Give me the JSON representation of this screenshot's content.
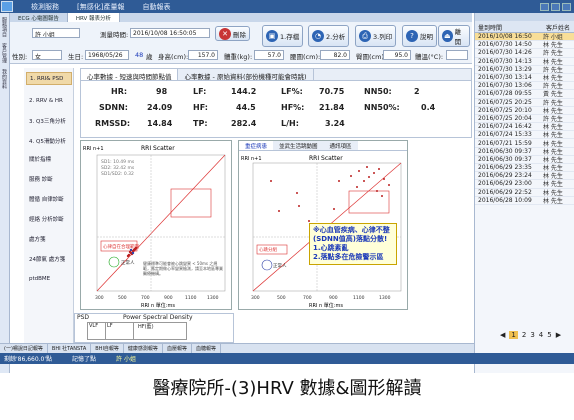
{
  "window": {
    "tab1": "檢測服務",
    "tab2": "[無感化]產量報",
    "tab3": "自動報表"
  },
  "left_rail": [
    "服務項目",
    "客戶管理",
    "我的資料"
  ],
  "tabstrip": [
    "ECG 心電圖報告",
    "HRV 報表分析"
  ],
  "form": {
    "name_label": "許 小姐",
    "measure_label": "測量時間:",
    "measure_value": "2016/10/08 16:50:05",
    "delete": "刪除",
    "gender_label": "性別:",
    "gender_value": "女",
    "birth_label": "生日:",
    "birth_value": "1968/05/26",
    "age": "48",
    "age_unit": "歲",
    "height_label": "身高(cm):",
    "height_value": "157.0",
    "weight_label": "體重(kg):",
    "weight_value": "57.0",
    "fat_label": "腰圍(cm):",
    "fat_value": "82.0",
    "hip_label": "臀圍(cm):",
    "hip_value": "95.0",
    "bmi_label": "體溫(°C):"
  },
  "toolbar": {
    "save": "1.存檔",
    "analyze": "2.分析",
    "print": "3.列印",
    "help": "說明",
    "exit": "離開"
  },
  "sidenav": [
    "1. RRI& PSD",
    "2. RRV & HR",
    "3. Q3三角分析",
    "4. Q5滑動分析",
    "關於指標",
    "服務 診斷",
    "體循 自律診斷",
    "經絡 分析診斷",
    "處方箋",
    "24節氣 處方箋",
    "ptdBME"
  ],
  "panel_tabs": [
    "心率數據 - 短速與時間節點值",
    "心率數據 - 原始資料(部份機種可能會時跳)"
  ],
  "stats": {
    "hr_l": "HR:",
    "hr_v": "98",
    "lf_l": "LF:",
    "lf_v": "144.2",
    "lfp_l": "LF%:",
    "lfp_v": "70.75",
    "nn50_l": "NN50:",
    "nn50_v": "2",
    "sdnn_l": "SDNN:",
    "sdnn_v": "24.09",
    "hf_l": "HF:",
    "hf_v": "44.5",
    "hfp_l": "HF%:",
    "hfp_v": "21.84",
    "nn50p_l": "NN50%:",
    "nn50p_v": "0.4",
    "rmssd_l": "RMSSD:",
    "rmssd_v": "14.84",
    "tp_l": "TP:",
    "tp_v": "282.4",
    "lh_l": "L/H:",
    "lh_v": "3.24"
  },
  "scatter1": {
    "title": "RRI Scatter",
    "xlabel": "RRI n 單位:ms",
    "ylabel": "RRI n+1",
    "sd1": "SD1: 10.49 ms",
    "sd2": "SD2: 32.42 ms",
    "ratio": "SD1/SD2: 0.32",
    "xticks": [
      "300",
      "500",
      "700",
      "900",
      "1100",
      "1300"
    ],
    "note1": "心律自在合理範圍",
    "note2": "正常人",
    "note3": "健康標準可能會被心跳變異 < 50ms 之規範，應定期做心率變異檢測，請至本地區專業醫療機構。"
  },
  "scatter2_tabs": [
    "重症病患",
    "並武生活跳動圖",
    "通訊項區"
  ],
  "scatter2": {
    "title": "RRI Scatter",
    "xlabel": "RRI n 單位:ms",
    "ylabel": "RRI n+1",
    "xticks": [
      "300",
      "500",
      "700",
      "900",
      "1100",
      "1300"
    ],
    "tip1": "※心血管疾病、心律不整",
    "tip2": "(SDNN值高)落點分散!",
    "tip3": "1.心跳紊亂",
    "tip4": "2.落點多在危險警示區",
    "note1": "心跳分組",
    "note2": "正常人"
  },
  "psd": {
    "label": "PSD",
    "title": "Power Spectral Density",
    "vlf": "VLF",
    "lf": "LF",
    "hf": "HF(藍)"
  },
  "right": {
    "col1": "量到時間",
    "col2": "客戶姓名",
    "rows": [
      {
        "d": "2016/10/08 16:50",
        "n": "許 小姐"
      },
      {
        "d": "2016/07/30 14:50",
        "n": "林 先生"
      },
      {
        "d": "2016/07/30 14:26",
        "n": "許 先生"
      },
      {
        "d": "2016/07/30 14:13",
        "n": "林 先生"
      },
      {
        "d": "2016/07/30 13:29",
        "n": "許 先生"
      },
      {
        "d": "2016/07/30 13:14",
        "n": "林 先生"
      },
      {
        "d": "2016/07/30 13:06",
        "n": "許 先生"
      },
      {
        "d": "2016/07/28 09:55",
        "n": "黃 先生"
      },
      {
        "d": "2016/07/25 20:25",
        "n": "許 先生"
      },
      {
        "d": "2016/07/25 20:10",
        "n": "林 先生"
      },
      {
        "d": "2016/07/25 20:04",
        "n": "許 先生"
      },
      {
        "d": "2016/07/24 16:42",
        "n": "林 先生"
      },
      {
        "d": "2016/07/24 15:33",
        "n": "林 先生"
      },
      {
        "d": "2016/07/21 15:59",
        "n": "林 先生"
      },
      {
        "d": "2016/06/30 09:37",
        "n": "林 先生"
      },
      {
        "d": "2016/06/30 09:37",
        "n": "林 先生"
      },
      {
        "d": "2016/06/29 23:35",
        "n": "林 先生"
      },
      {
        "d": "2016/06/29 23:24",
        "n": "林 先生"
      },
      {
        "d": "2016/06/29 23:00",
        "n": "林 先生"
      },
      {
        "d": "2016/06/29 22:52",
        "n": "林 先生"
      },
      {
        "d": "2016/06/28 10:09",
        "n": "林 先生"
      }
    ]
  },
  "pager": [
    "1",
    "2",
    "3",
    "4",
    "5"
  ],
  "bottomtabs": [
    "(一)嘯說日記報等",
    "BHI 社TANSTA",
    "BHI自報等",
    "健康感測報等",
    "血壓報等",
    "血糖報等"
  ],
  "status": {
    "left": "剩餘'86,660.0'點",
    "mid": "記憶了點",
    "user": "許 小姐"
  },
  "caption": "醫療院所-(3)HRV 數據&圖形解讀"
}
